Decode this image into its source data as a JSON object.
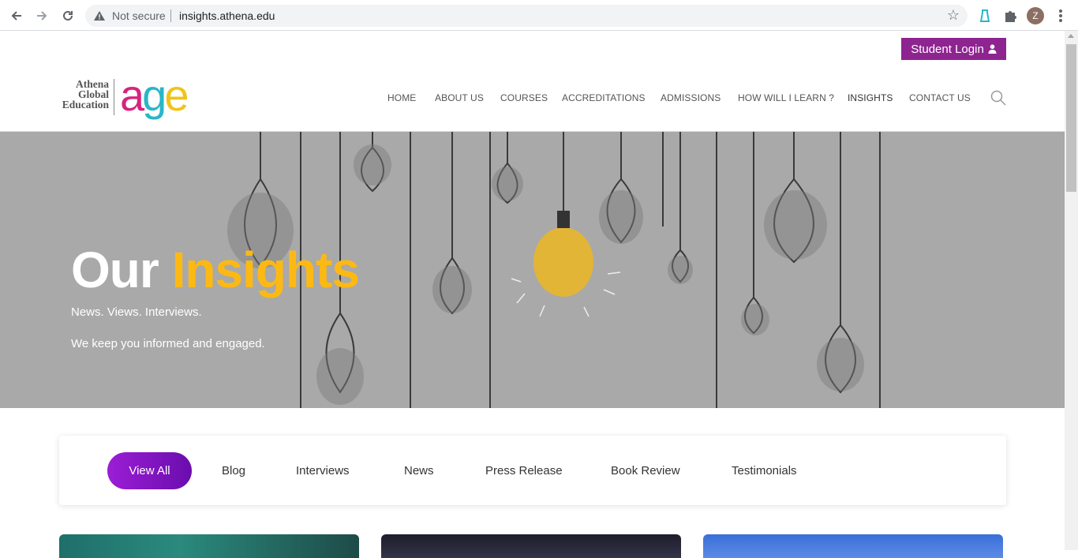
{
  "browser": {
    "security_label": "Not secure",
    "url": "insights.athena.edu",
    "profile_initial": "Z"
  },
  "header": {
    "login_label": "Student Login",
    "logo": {
      "line1": "Athena",
      "line2": "Global",
      "line3": "Education",
      "mark": "age",
      "mark_colors": [
        "#d6247f",
        "#8e2490",
        "#29b6c8",
        "#f0c419"
      ]
    },
    "nav": [
      {
        "label": "HOME"
      },
      {
        "label": "ABOUT US"
      },
      {
        "label": "COURSES"
      },
      {
        "label": "ACCREDITATIONS"
      },
      {
        "label": "ADMISSIONS"
      },
      {
        "label": "HOW WILL I LEARN ?"
      },
      {
        "label": "INSIGHTS"
      },
      {
        "label": "CONTACT US"
      }
    ]
  },
  "hero": {
    "title_part1": "Our ",
    "title_part2": "Insights",
    "subtitle1": "News. Views. Interviews.",
    "subtitle2": "We keep you informed and engaged."
  },
  "filters": [
    {
      "label": "View All",
      "active": true
    },
    {
      "label": "Blog",
      "active": false
    },
    {
      "label": "Interviews",
      "active": false
    },
    {
      "label": "News",
      "active": false
    },
    {
      "label": "Press Release",
      "active": false
    },
    {
      "label": "Book Review",
      "active": false
    },
    {
      "label": "Testimonials",
      "active": false
    }
  ],
  "colors": {
    "brand_purple": "#8e2490",
    "accent_yellow": "#fdb913",
    "hero_bg": "#a9a9a9"
  }
}
